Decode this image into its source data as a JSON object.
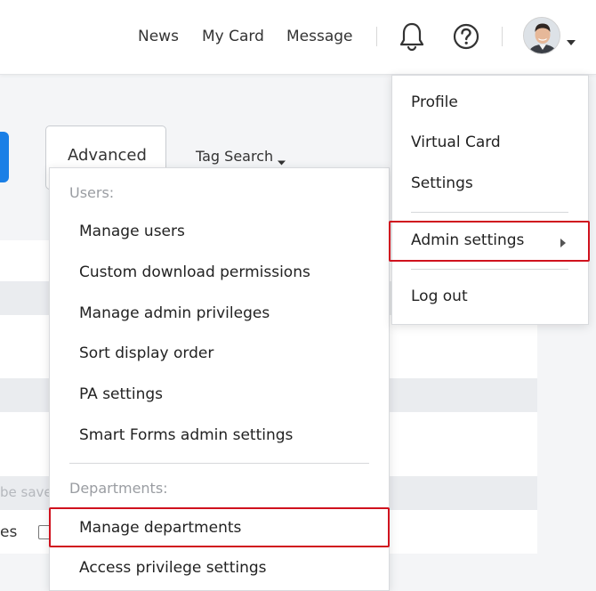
{
  "header": {
    "nav": {
      "news": "News",
      "my_card": "My Card",
      "message": "Message"
    },
    "icons": {
      "bell": "bell-icon",
      "help": "help-circle-icon",
      "avatar_caret": "caret-down-icon"
    }
  },
  "toolbar": {
    "advanced_label": "Advanced",
    "tag_search_label": "Tag Search",
    "primary_color": "#1a7fe6"
  },
  "background": {
    "faded_text": "be save",
    "row_text": "es"
  },
  "admin_submenu": {
    "users_heading": "Users:",
    "users_items": [
      "Manage users",
      "Custom download permissions",
      "Manage admin privileges",
      "Sort display order",
      "PA settings",
      "Smart Forms admin settings"
    ],
    "departments_heading": "Departments:",
    "departments_items": [
      "Manage departments",
      "Access privilege settings"
    ]
  },
  "profile_menu": {
    "items": {
      "profile": "Profile",
      "virtual_card": "Virtual Card",
      "settings": "Settings",
      "admin_settings": "Admin settings",
      "log_out": "Log out"
    }
  },
  "colors": {
    "highlight": "#d0121e",
    "page_bg": "#f4f5f7",
    "band_bg": "#eaecef"
  }
}
